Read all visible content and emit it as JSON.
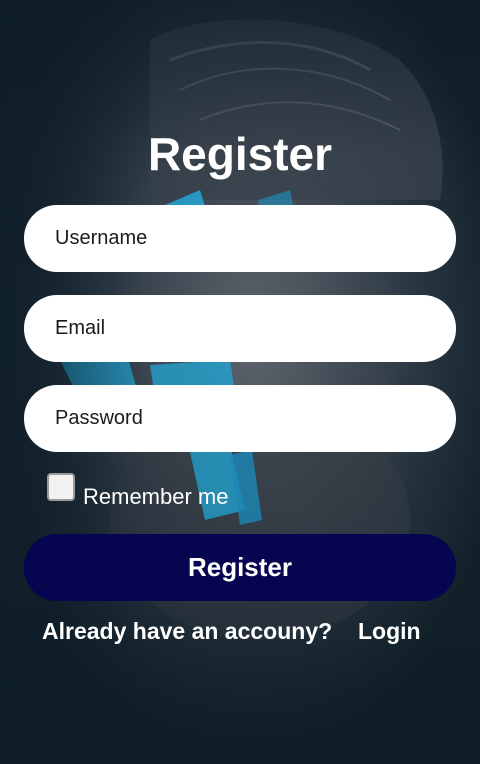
{
  "form": {
    "title": "Register",
    "username_placeholder": "Username",
    "email_placeholder": "Email",
    "password_placeholder": "Password",
    "remember_label": "Remember me",
    "remember_checked": false,
    "submit_label": "Register"
  },
  "footer": {
    "prompt_text": "Already have an accouny?",
    "login_label": "Login"
  },
  "colors": {
    "background": "#14232e",
    "button": "#060550",
    "accent_paint": "#29b6e8"
  }
}
